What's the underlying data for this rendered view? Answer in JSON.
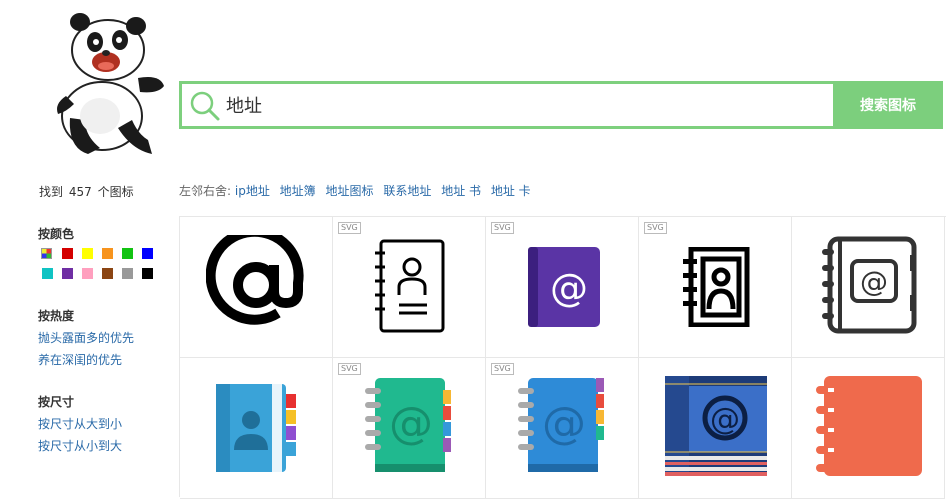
{
  "search": {
    "value": "地址",
    "button_label": "搜索图标"
  },
  "results": {
    "prefix": "找到",
    "count": "457",
    "suffix": "个图标"
  },
  "neighbors": {
    "label": "左邻右舍:",
    "items": [
      "ip地址",
      "地址簿",
      "地址图标",
      "联系地址",
      "地址 书",
      "地址 卡"
    ]
  },
  "filters": {
    "color_title": "按颜色",
    "colors": [
      "multicolor",
      "#d40000",
      "#ffff00",
      "#f7941d",
      "#12c312",
      "#0000ff",
      "#10c3c3",
      "#6f2ea3",
      "#ff9fbe",
      "#8b4513",
      "#999999",
      "#000000"
    ],
    "popularity_title": "按热度",
    "popularity_options": [
      "抛头露面多的优先",
      "养在深闺的优先"
    ],
    "size_title": "按尺寸",
    "size_options": [
      "按尺寸从大到小",
      "按尺寸从小到大"
    ]
  },
  "grid": {
    "svg_badge": "SVG",
    "icons": [
      {
        "icon": "at-sign-icon",
        "svg": false
      },
      {
        "icon": "contact-book-outline-icon",
        "svg": true
      },
      {
        "icon": "purple-at-book-icon",
        "svg": true
      },
      {
        "icon": "contact-book-bold-icon",
        "svg": true
      },
      {
        "icon": "at-notebook-outline-icon",
        "svg": false
      },
      {
        "icon": "blue-address-book-icon",
        "svg": false
      },
      {
        "icon": "green-at-notebook-icon",
        "svg": true
      },
      {
        "icon": "blue-at-notebook-icon",
        "svg": true
      },
      {
        "icon": "navy-at-book-icon",
        "svg": false
      },
      {
        "icon": "orange-notebook-icon",
        "svg": false
      }
    ]
  }
}
